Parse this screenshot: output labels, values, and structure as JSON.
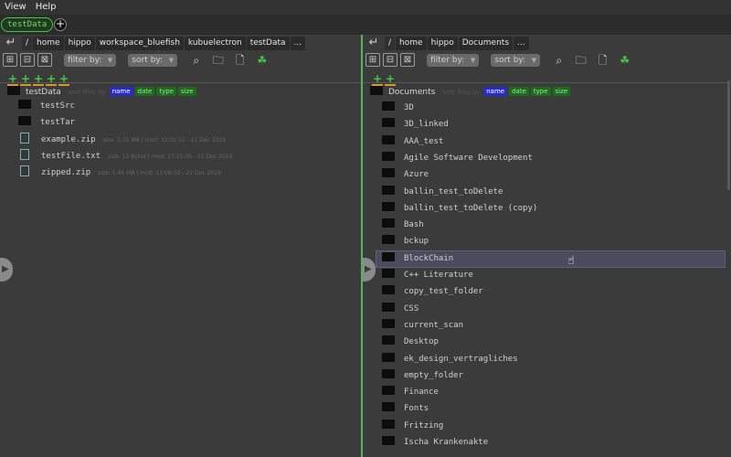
{
  "menu": {
    "items": [
      "View",
      "Help"
    ]
  },
  "tabs": [
    {
      "label": "testData"
    }
  ],
  "icons": {
    "back": "back-arrow-icon",
    "new_tab": "plus-icon",
    "search": "search-icon",
    "folder": "folder-icon",
    "file": "file-icon",
    "tree": "tree-icon"
  },
  "colors": {
    "accent": "#46c846",
    "selected_chip": "#2a2ac8",
    "divider": "#59b359",
    "underline": "#d9962a"
  },
  "left": {
    "breadcrumb": [
      "/",
      "home",
      "hippo",
      "workspace_bluefish",
      "kubuelectron",
      "testData",
      "..."
    ],
    "filter_placeholder": "filter by:",
    "sort_label": "sort by:",
    "root": {
      "name": "testData",
      "sort_hint": "sort files by",
      "chips": [
        "name",
        "date",
        "type",
        "size"
      ]
    },
    "entries": [
      {
        "kind": "folder",
        "name": "testSrc",
        "meta": ""
      },
      {
        "kind": "folder",
        "name": "testTar",
        "meta": ""
      },
      {
        "kind": "file",
        "name": "example.zip",
        "meta": "size: 1.31 MB  |  mod: 12:02:11 - 21 Dec 2019"
      },
      {
        "kind": "file",
        "name": "testFile.txt",
        "meta": "size: 12 Bytes  |  mod: 17:21:05 - 11 Dec 2019"
      },
      {
        "kind": "file",
        "name": "zipped.zip",
        "meta": "size: 1.45 MB  |  mod: 12:08:50 - 22 Dec 2019"
      }
    ]
  },
  "right": {
    "breadcrumb": [
      "/",
      "home",
      "hippo",
      "Documents",
      "..."
    ],
    "filter_placeholder": "filter by:",
    "sort_label": "sort by:",
    "root": {
      "name": "Documents",
      "sort_hint": "sort files by",
      "chips": [
        "name",
        "date",
        "type",
        "size"
      ]
    },
    "highlighted_index": 9,
    "entries": [
      "3D",
      "3D_linked",
      "AAA_test",
      "Agile Software Development",
      "Azure",
      "ballin_test_toDelete",
      "ballin_test_toDelete (copy)",
      "Bash",
      "bckup",
      "BlockChain",
      "C++ Literature",
      "copy_test_folder",
      "CSS",
      "current_scan",
      "Desktop",
      "ek_design_vertragliches",
      "empty_folder",
      "Finance",
      "Fonts",
      "Fritzing",
      "Ischa Krankenakte"
    ]
  }
}
